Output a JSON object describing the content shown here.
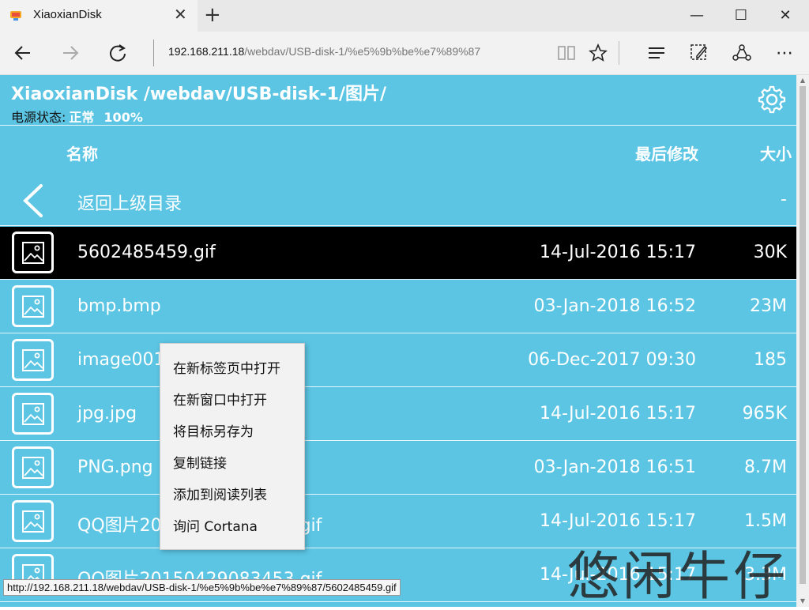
{
  "browser": {
    "tab_title": "XiaoxianDisk",
    "address_host": "192.168.211.18",
    "address_path": "/webdav/USB-disk-1/%e5%9b%be%e7%89%87"
  },
  "page": {
    "title": "XiaoxianDisk /webdav/USB-disk-1/图片/",
    "power_label": "电源状态:",
    "power_status": "正常",
    "power_percent": "100%",
    "columns": {
      "name": "名称",
      "modified": "最后修改",
      "size": "大小"
    },
    "parent": {
      "label": "返回上级目录",
      "size": "-"
    },
    "rows": [
      {
        "name": "5602485459.gif",
        "date": "14-Jul-2016 15:17",
        "size": "30K"
      },
      {
        "name": "bmp.bmp",
        "date": "03-Jan-2018 16:52",
        "size": "23M"
      },
      {
        "name": "image001",
        "date": "06-Dec-2017 09:30",
        "size": "185"
      },
      {
        "name": "jpg.jpg",
        "date": "14-Jul-2016 15:17",
        "size": "965K"
      },
      {
        "name": "PNG.png",
        "date": "03-Jan-2018 16:51",
        "size": "8.7M"
      },
      {
        "name": "QQ图片20141030164231.gif",
        "date": "14-Jul-2016 15:17",
        "size": "1.5M"
      },
      {
        "name": "QQ图片20150429083453.gif",
        "date": "14-Jul-2016 15:17",
        "size": "3.3M"
      }
    ]
  },
  "context_menu": [
    "在新标签页中打开",
    "在新窗口中打开",
    "将目标另存为",
    "复制链接",
    "添加到阅读列表",
    "询问 Cortana"
  ],
  "status_url": "http://192.168.211.18/webdav/USB-disk-1/%e5%9b%be%e7%89%87/5602485459.gif",
  "watermark": "悠闲牛仔"
}
